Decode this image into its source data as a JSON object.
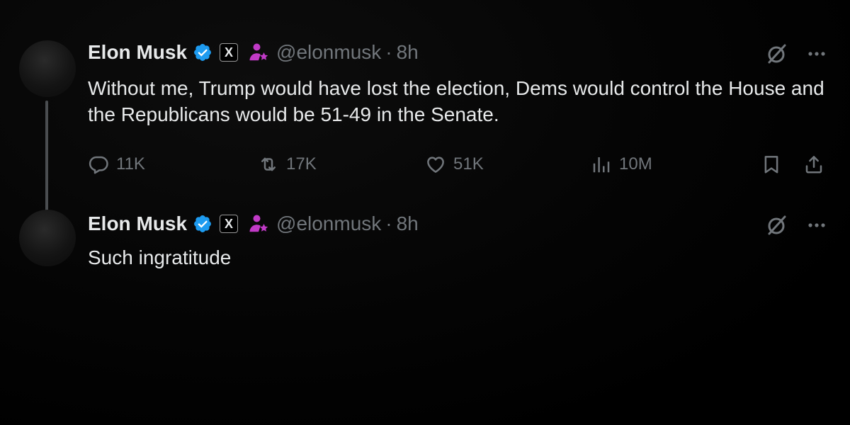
{
  "tweets": [
    {
      "author": "Elon Musk",
      "handle": "@elonmusk",
      "separator": "·",
      "time": "8h",
      "x_badge": "X",
      "text": "Without me, Trump would have lost the election, Dems would control the House and the Republicans would be 51-49 in the Senate.",
      "stats": {
        "replies": "11K",
        "reposts": "17K",
        "likes": "51K",
        "views": "10M"
      }
    },
    {
      "author": "Elon Musk",
      "handle": "@elonmusk",
      "separator": "·",
      "time": "8h",
      "x_badge": "X",
      "text": "Such ingratitude"
    }
  ],
  "colors": {
    "background": "#000000",
    "text_primary": "#e7e9ea",
    "text_secondary": "#71767b",
    "verified_blue": "#1d9bf0",
    "affiliate_purple": "#c13ac7"
  },
  "icons": {
    "verified": "verified-badge-icon",
    "affiliate": "affiliate-person-icon",
    "grok": "grok-icon",
    "more": "more-icon",
    "reply": "reply-icon",
    "repost": "repost-icon",
    "like": "heart-icon",
    "views": "views-icon",
    "bookmark": "bookmark-icon",
    "share": "share-icon"
  }
}
